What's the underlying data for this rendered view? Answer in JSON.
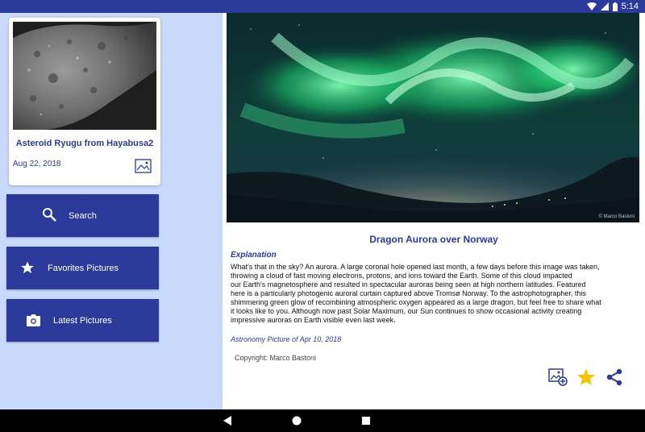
{
  "status_bar": {
    "time": "5:14",
    "icons": [
      "wifi-icon",
      "cellular-signal-icon",
      "battery-icon"
    ]
  },
  "featured_card": {
    "title": "Asteroid Ryugu from Hayabusa2",
    "date": "Aug 22, 2018",
    "image_icon": "image-icon"
  },
  "nav_buttons": [
    {
      "label": "Search",
      "icon": "search-icon"
    },
    {
      "label": "Favorites Pictures",
      "icon": "star-icon"
    },
    {
      "label": "Latest Pictures",
      "icon": "camera-icon"
    }
  ],
  "detail": {
    "image_credit": "© Marco Bastoni",
    "title": "Dragon Aurora over Norway",
    "explanation_heading": "Explanation",
    "explanation": "What's that in the sky? An aurora. A large coronal hole opened last month, a few days before this image was taken,\nthrowing a cloud of fast moving electrons, protons, and ions toward the Earth. Some of this cloud impacted\nour Earth's magnetosphere and resulted in spectacular auroras being seen at high northern latitudes. Featured\nhere is a particularly photogenic auroral curtain captured above Tromsø Norway. To the astrophotographer, this\nshimmering green glow of recombining atmospheric oxygen appeared as a large dragon, but feel free to share what\nit looks like to you.  Although now past Solar Maximum, our Sun continues to show occasional activity creating\nimpressive auroras on Earth visible even last week.",
    "date_line": "Astronomy Picture of Apr 10, 2018",
    "copyright": "Copyright: Marco Bastoni",
    "actions": [
      "set-wallpaper-icon",
      "favorite-star-icon",
      "share-icon"
    ]
  },
  "colors": {
    "primary": "#2b3a9b",
    "sidebar_background": "#c9d9fb",
    "favorite": "#f5c400"
  },
  "system_nav": [
    "back-icon",
    "home-icon",
    "recents-icon"
  ]
}
